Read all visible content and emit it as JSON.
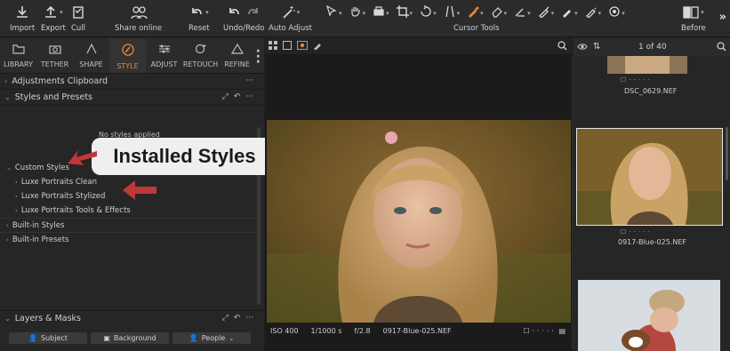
{
  "toolbar": {
    "import": "Import",
    "export": "Export",
    "cull": "Cull",
    "share_online": "Share online",
    "reset": "Reset",
    "undo_redo": "Undo/Redo",
    "auto_adjust": "Auto Adjust",
    "cursor_tools": "Cursor Tools",
    "before": "Before"
  },
  "tabs": [
    {
      "label": "LIBRARY",
      "icon": "folder-icon"
    },
    {
      "label": "TETHER",
      "icon": "camera-icon"
    },
    {
      "label": "SHAPE",
      "icon": "shape-icon"
    },
    {
      "label": "STYLE",
      "icon": "style-icon",
      "active": true
    },
    {
      "label": "ADJUST",
      "icon": "sliders-icon"
    },
    {
      "label": "RETOUCH",
      "icon": "retouch-icon"
    },
    {
      "label": "REFINE",
      "icon": "refine-icon"
    }
  ],
  "left_panel": {
    "adjustments_clipboard": "Adjustments Clipboard",
    "styles_and_presets": "Styles and Presets",
    "no_styles": "No styles applied",
    "custom_styles": "Custom Styles",
    "custom_items": [
      "Luxe Portraits Clean",
      "Luxe Portraits Stylized",
      "Luxe Portraits Tools & Effects"
    ],
    "built_in_styles": "Built-in Styles",
    "built_in_presets": "Built-in Presets",
    "layers_masks": "Layers & Masks",
    "subject": "Subject",
    "background": "Background",
    "people": "People"
  },
  "callout": {
    "text": "Installed Styles"
  },
  "viewer": {
    "iso": "ISO 400",
    "shutter": "1/1000 s",
    "aperture": "f/2.8",
    "filename": "0917-Blue-025.NEF"
  },
  "browser": {
    "page_count": "1 of 40",
    "thumbs": [
      {
        "caption": "DSC_0629.NEF"
      },
      {
        "caption": "0917-Blue-025.NEF",
        "selected": true
      },
      {
        "caption": ""
      }
    ]
  },
  "colors": {
    "accent": "#e6873a",
    "arrow": "#c0383a"
  }
}
